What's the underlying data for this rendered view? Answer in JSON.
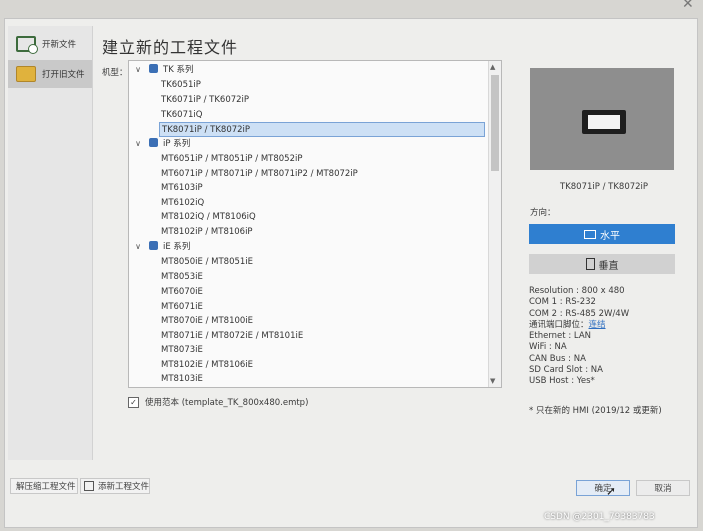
{
  "window": {
    "close_glyph": "✕"
  },
  "sidebar": {
    "items": [
      {
        "label": "开新文件",
        "icon": "new-file-icon"
      },
      {
        "label": "打开旧文件",
        "icon": "folder-icon"
      }
    ]
  },
  "main": {
    "title": "建立新的工程文件",
    "model_label": "机型：",
    "groups": [
      {
        "name": "TK 系列",
        "items": [
          "TK6051iP",
          "TK6071iP / TK6072iP",
          "TK6071iQ",
          "TK8071iP / TK8072iP"
        ]
      },
      {
        "name": "iP 系列",
        "items": [
          "MT6051iP / MT8051iP / MT8052iP",
          "MT6071iP / MT8071iP / MT8071iP2 / MT8072iP",
          "MT6103iP",
          "MT6102iQ",
          "MT8102iQ / MT8106iQ",
          "MT8102iP / MT8106iP"
        ]
      },
      {
        "name": "iE 系列",
        "items": [
          "MT8050iE / MT8051iE",
          "MT8053iE",
          "MT6070iE",
          "MT6071iE",
          "MT8070iE / MT8100iE",
          "MT8071iE / MT8072iE / MT8101iE",
          "MT8073iE",
          "MT8102iE / MT8106iE",
          "MT8103iE"
        ]
      }
    ],
    "selected": "TK8071iP / TK8072iP",
    "template": {
      "checked": true,
      "label": "使用范本 (template_TK_800x480.emtp)"
    }
  },
  "preview": {
    "caption": "TK8071iP / TK8072iP",
    "orientation_label": "方向：",
    "horizontal_label": "水平",
    "vertical_label": "垂直",
    "specs": [
      "Resolution : 800 x 480",
      "COM 1 : RS-232",
      "COM 2 : RS-485 2W/4W",
      "Ethernet : LAN",
      "WiFi : NA",
      "CAN Bus : NA",
      "SD Card Slot : NA",
      "USB Host : Yes*"
    ],
    "port_label": "通讯端口脚位：",
    "port_link": "连结",
    "note": "* 只在新的 HMI (2019/12 或更新)",
    "accent_color": "#2f7fd0"
  },
  "footer": {
    "unzip_label": "解压缩工程文件",
    "add_label": "添新工程文件",
    "ok_label": "确定",
    "cancel_label": "取消"
  },
  "watermark": "CSDN @2301_79383783"
}
